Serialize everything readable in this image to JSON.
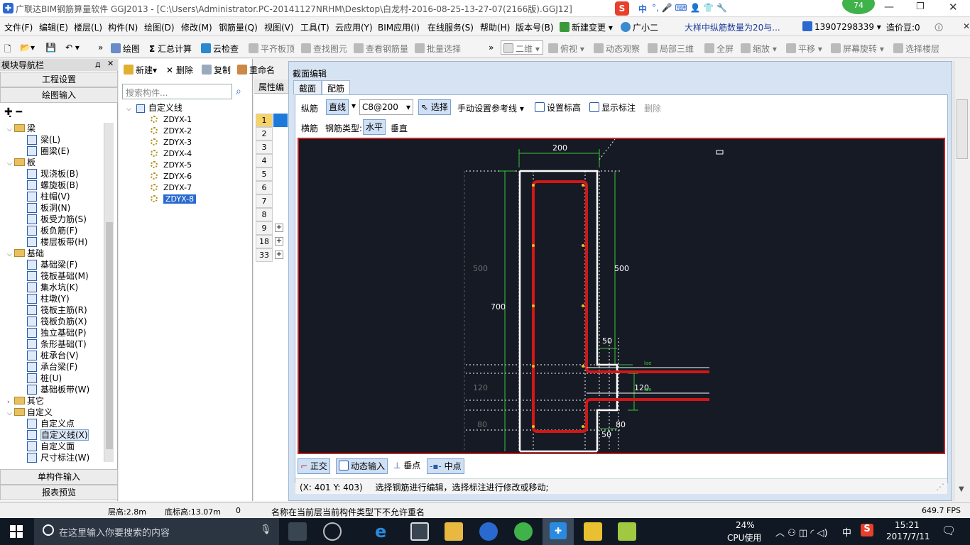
{
  "window": {
    "title": "广联达BIM钢筋算量软件 GGJ2013 - [C:\\Users\\Administrator.PC-20141127NRHM\\Desktop\\白龙村-2016-08-25-13-27-07(2166版).GGJ12]",
    "badge": "74",
    "ime": "中"
  },
  "menu": [
    "文件(F)",
    "编辑(E)",
    "楼层(L)",
    "构件(N)",
    "绘图(D)",
    "修改(M)",
    "钢筋量(Q)",
    "视图(V)",
    "工具(T)",
    "云应用(Y)",
    "BIM应用(I)",
    "在线服务(S)",
    "帮助(H)",
    "版本号(B)"
  ],
  "menu_extra": {
    "new_change": "新建变更",
    "guangxiao": "广小二",
    "notice": "大样中纵筋数量为20与...",
    "phone": "13907298339",
    "price_bean": "造价豆:0"
  },
  "toolbar": {
    "draw": "绘图",
    "sum": "汇总计算",
    "cloud_check": "云检查",
    "flush_slab": "平齐板顶",
    "find_elem": "查找图元",
    "view_rebar": "查看钢筋量",
    "batch_select": "批量选择",
    "view_mode": "二维",
    "top_view": "俯视",
    "dynamic_view": "动态观察",
    "local_3d": "局部三维",
    "fullscreen": "全屏",
    "zoom": "缩放",
    "pan": "平移",
    "rotate": "屏幕旋转",
    "select_floor": "选择楼层"
  },
  "nav": {
    "title": "模块导航栏",
    "pin": "д",
    "close": "✕",
    "project_settings": "工程设置",
    "drawing_input": "绘图输入",
    "single_input": "单构件输入",
    "report_preview": "报表预览",
    "tree": [
      {
        "label": "梁",
        "kind": "folder",
        "level": 0
      },
      {
        "label": "梁(L)",
        "kind": "item",
        "level": 1
      },
      {
        "label": "圈梁(E)",
        "kind": "item",
        "level": 1
      },
      {
        "label": "板",
        "kind": "folder",
        "level": 0
      },
      {
        "label": "现浇板(B)",
        "kind": "item",
        "level": 1
      },
      {
        "label": "螺旋板(B)",
        "kind": "item",
        "level": 1
      },
      {
        "label": "柱帽(V)",
        "kind": "item",
        "level": 1
      },
      {
        "label": "板洞(N)",
        "kind": "item",
        "level": 1
      },
      {
        "label": "板受力筋(S)",
        "kind": "item",
        "level": 1
      },
      {
        "label": "板负筋(F)",
        "kind": "item",
        "level": 1
      },
      {
        "label": "楼层板带(H)",
        "kind": "item",
        "level": 1
      },
      {
        "label": "基础",
        "kind": "folder",
        "level": 0
      },
      {
        "label": "基础梁(F)",
        "kind": "item",
        "level": 1
      },
      {
        "label": "筏板基础(M)",
        "kind": "item",
        "level": 1
      },
      {
        "label": "集水坑(K)",
        "kind": "item",
        "level": 1
      },
      {
        "label": "柱墩(Y)",
        "kind": "item",
        "level": 1
      },
      {
        "label": "筏板主筋(R)",
        "kind": "item",
        "level": 1
      },
      {
        "label": "筏板负筋(X)",
        "kind": "item",
        "level": 1
      },
      {
        "label": "独立基础(P)",
        "kind": "item",
        "level": 1
      },
      {
        "label": "条形基础(T)",
        "kind": "item",
        "level": 1
      },
      {
        "label": "桩承台(V)",
        "kind": "item",
        "level": 1
      },
      {
        "label": "承台梁(F)",
        "kind": "item",
        "level": 1
      },
      {
        "label": "桩(U)",
        "kind": "item",
        "level": 1
      },
      {
        "label": "基础板带(W)",
        "kind": "item",
        "level": 1
      },
      {
        "label": "其它",
        "kind": "folder-closed",
        "level": 0
      },
      {
        "label": "自定义",
        "kind": "folder",
        "level": 0
      },
      {
        "label": "自定义点",
        "kind": "item",
        "level": 1
      },
      {
        "label": "自定义线(X)",
        "kind": "item",
        "level": 1,
        "selected": true
      },
      {
        "label": "自定义面",
        "kind": "item",
        "level": 1
      },
      {
        "label": "尺寸标注(W)",
        "kind": "item",
        "level": 1
      }
    ]
  },
  "components": {
    "new": "新建",
    "delete": "删除",
    "copy": "复制",
    "rename": "重命名",
    "search_placeholder": "搜索构件...",
    "group": "自定义线",
    "items": [
      "ZDYX-1",
      "ZDYX-2",
      "ZDYX-3",
      "ZDYX-4",
      "ZDYX-5",
      "ZDYX-6",
      "ZDYX-7",
      "ZDYX-8"
    ],
    "selected": "ZDYX-8"
  },
  "props": {
    "title": "属性编",
    "rows": [
      "1",
      "2",
      "3",
      "4",
      "5",
      "6",
      "7",
      "8",
      "9",
      "18",
      "33"
    ]
  },
  "dialog": {
    "title": "截面编辑",
    "tabs": [
      "截面",
      "配筋"
    ],
    "active_tab": "配筋",
    "long_bar": "纵筋",
    "line": "直线",
    "spec": "C8@200",
    "select": "选择",
    "manual_ref": "手动设置参考线",
    "set_elev": "设置标高",
    "show_label": "显示标注",
    "delete": "删除",
    "cross_bar": "横筋",
    "bar_type": "钢筋类型:",
    "horizontal": "水平",
    "vertical": "垂直",
    "dims": {
      "top": "200",
      "left_total": "700",
      "left_upper": "500",
      "right_upper": "500",
      "left_mid": "120",
      "right_mid": "120",
      "left_low": "80",
      "right_low": "80",
      "step_top": "50",
      "step_bot": "50",
      "lae1": "lae",
      "lae2": "lae"
    },
    "snap": {
      "ortho": "正交",
      "dyn_input": "动态输入",
      "perp": "垂点",
      "mid": "中点"
    },
    "coord": "(X: 401 Y: 403)",
    "hint": "选择钢筋进行编辑，选择标注进行修改或移动;"
  },
  "status": {
    "floor_h": "层高:2.8m",
    "base_h": "底标高:13.07m",
    "zero": "0",
    "msg": "名称在当前层当前构件类型下不允许重名",
    "fps": "649.7 FPS"
  },
  "taskbar": {
    "search": "在这里输入你要搜索的内容",
    "cpu_pct": "24%",
    "cpu_label": "CPU使用",
    "ime": "中",
    "time": "15:21",
    "date": "2017/7/11"
  },
  "colors": {
    "canvas_bg": "#161a24",
    "rebar": "#d01818",
    "frame": "#cc1f1f",
    "dim": "#37c837",
    "accent": "#2a6ad0"
  }
}
